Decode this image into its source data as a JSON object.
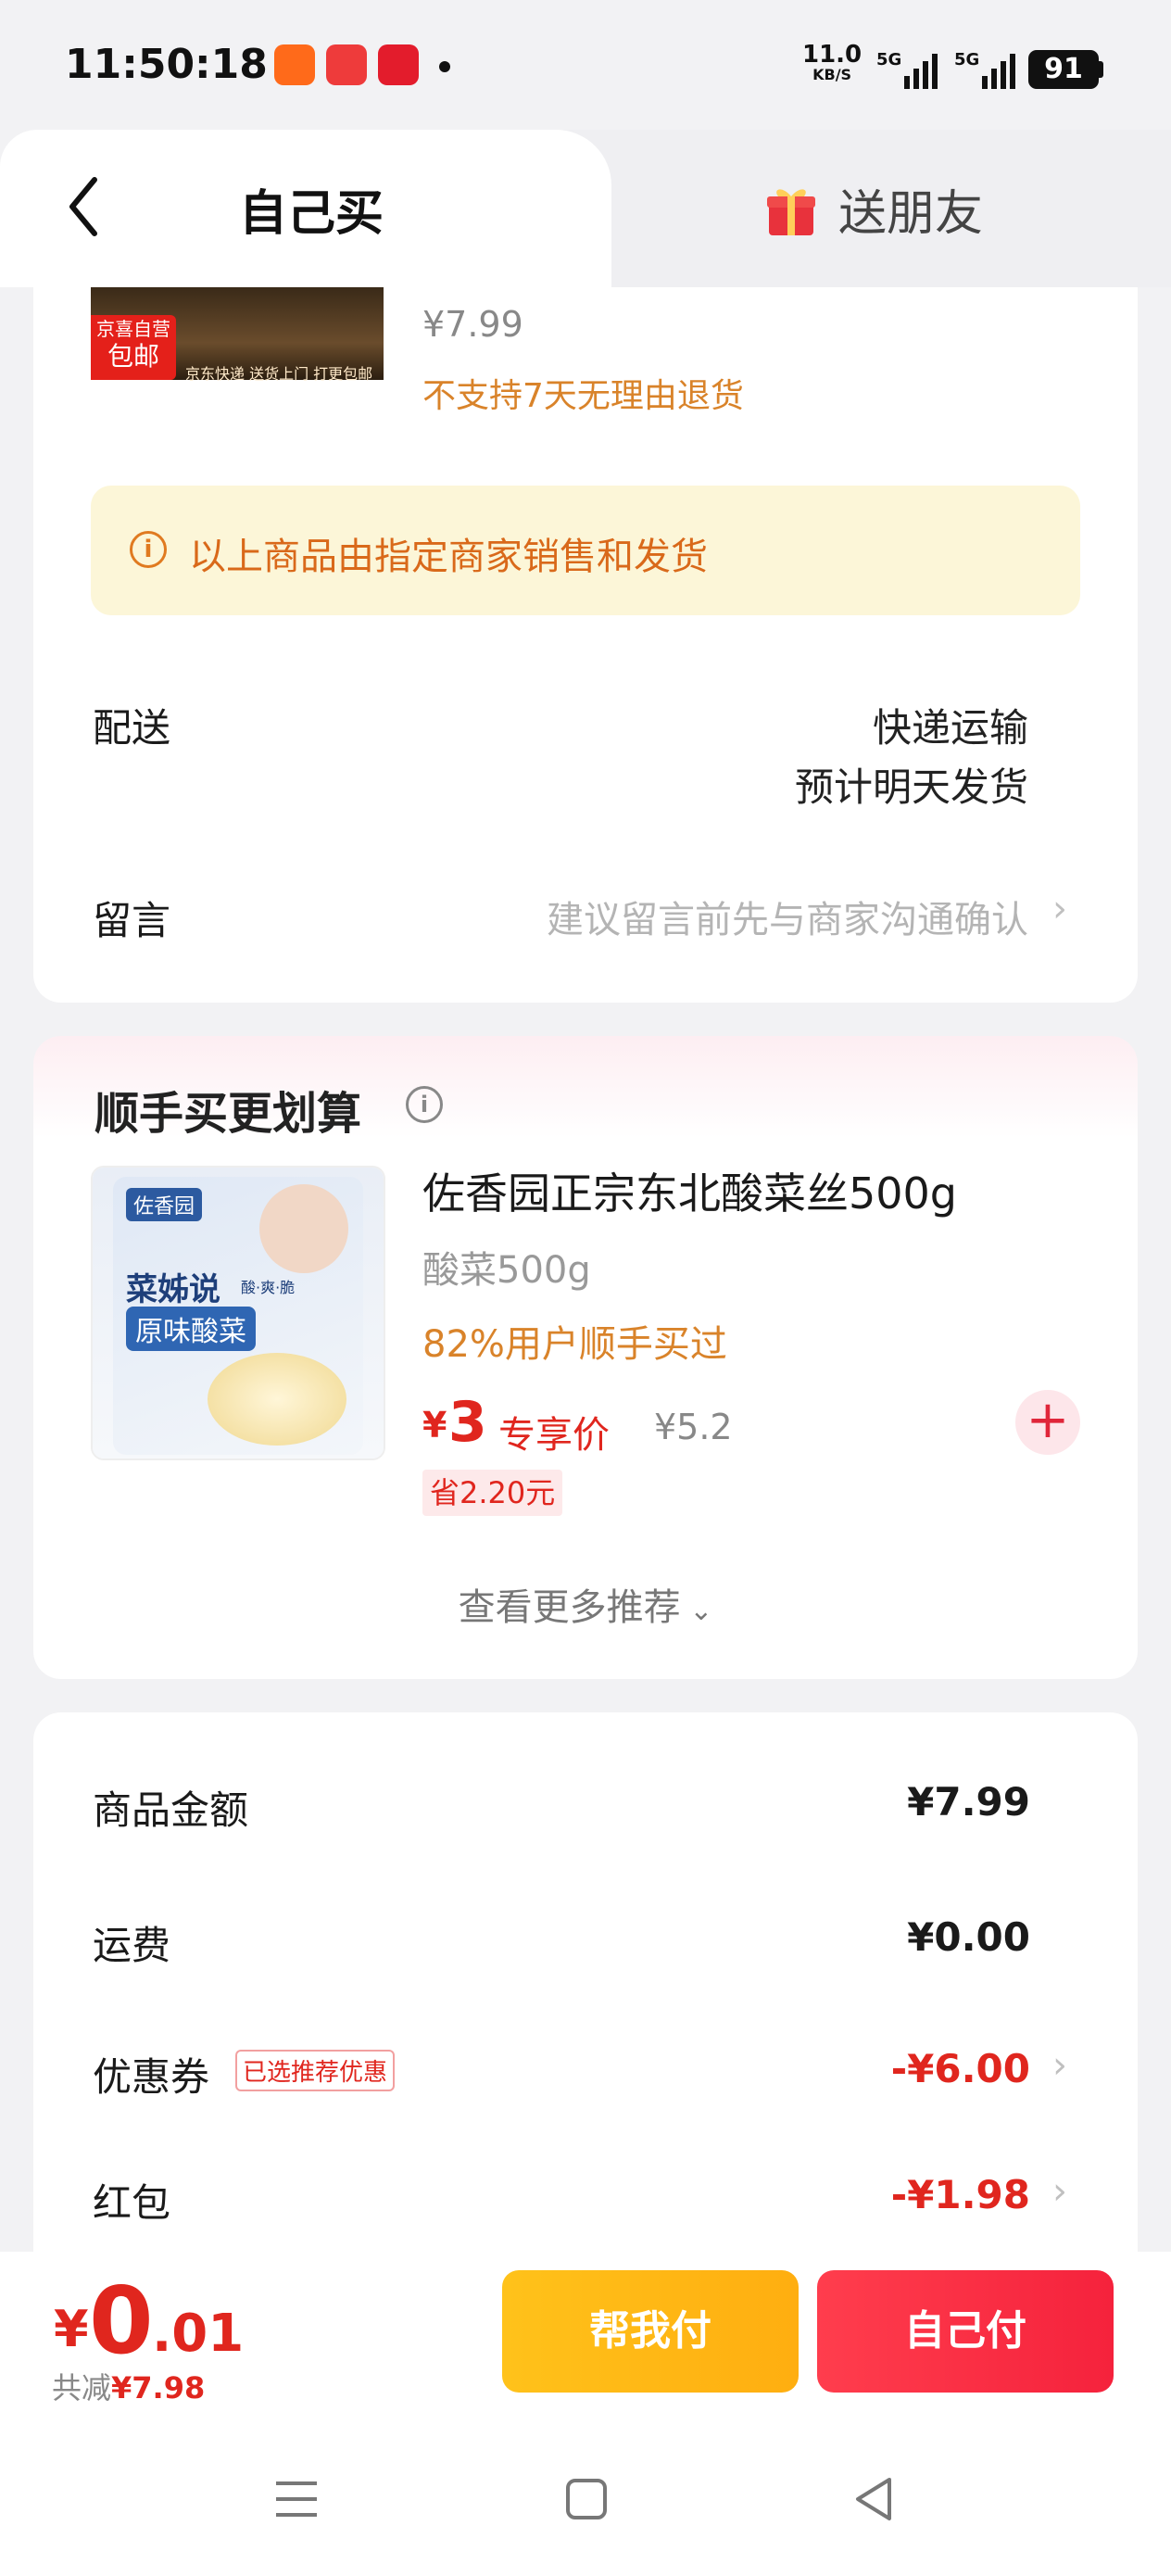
{
  "status_bar": {
    "time": "11:50:18",
    "net_speed": "11.0",
    "net_unit": "KB/S",
    "sig1": "5G",
    "sig2": "5G",
    "battery": "91"
  },
  "header": {
    "tab_self": "自己买",
    "tab_friend": "送朋友"
  },
  "order_item": {
    "badge_line1": "京喜自营",
    "badge_line2": "包邮",
    "image_strip_text": "京东快递 送货上门 打更包邮",
    "price": "¥7.99",
    "return_policy": "不支持7天无理由退货"
  },
  "notice": {
    "text": "以上商品由指定商家销售和发货"
  },
  "delivery": {
    "label": "配送",
    "method": "快递运输",
    "eta": "预计明天发货"
  },
  "message": {
    "label": "留言",
    "placeholder": "建议留言前先与商家沟通确认"
  },
  "recommend": {
    "title": "顺手买更划算",
    "product": {
      "name": "佐香园正宗东北酸菜丝500g",
      "spec": "酸菜500g",
      "buy_rate": "82%用户顺手买过",
      "yen": "¥",
      "price": "3",
      "price_tag": "专享价",
      "original_price": "¥5.2",
      "save": "省2.20元",
      "pack_brand": "佐香园",
      "pack_line1": "菜姊说",
      "pack_sub": "酸·爽·脆",
      "pack_line2": "原味酸菜"
    },
    "more": "查看更多推荐"
  },
  "summary": {
    "goods_label": "商品金额",
    "goods_value": "¥7.99",
    "shipping_label": "运费",
    "shipping_value": "¥0.00",
    "coupon_label": "优惠券",
    "coupon_chip": "已选推荐优惠",
    "coupon_value": "-¥6.00",
    "redpacket_label": "红包",
    "redpacket_value": "-¥1.98"
  },
  "checkout": {
    "yen": "¥",
    "total_int": "0",
    "total_dec": ".01",
    "reduce_label": "共减",
    "reduce_value": "¥7.98",
    "help_pay": "帮我付",
    "self_pay": "自己付"
  },
  "colors": {
    "accent_red": "#e0261e",
    "btn_yellow": "#ffb816",
    "btn_red": "#f5223c",
    "notice_bg": "#fcf6d8",
    "notice_text": "#d9691a"
  }
}
